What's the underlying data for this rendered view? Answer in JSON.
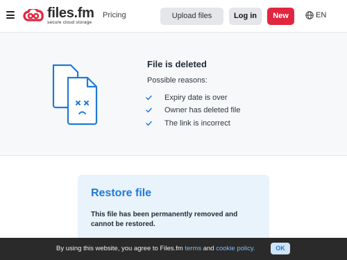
{
  "header": {
    "logo_text": "files.fm",
    "logo_tagline": "secure cloud storage",
    "pricing_label": "Pricing",
    "upload_label": "Upload files",
    "login_label": "Log in",
    "new_label": "New",
    "language": "EN"
  },
  "deleted": {
    "title": "File is deleted",
    "reasons_label": "Possible reasons:",
    "reasons": [
      "Expiry date is over",
      "Owner has deleted file",
      "The link is incorrect"
    ]
  },
  "restore": {
    "title": "Restore file",
    "message": "This file has been permanently removed and cannot be restored."
  },
  "cookie": {
    "text_before": "By using this website, you agree to Files.fm ",
    "terms_link": "terms",
    "text_and": " and ",
    "cookie_link": "cookie policy.",
    "ok_label": "OK"
  },
  "colors": {
    "brand_red": "#e2263f",
    "accent_blue": "#1f7ad6",
    "panel_bg": "#f7f8fa",
    "cookie_bg": "#2a2a2a"
  },
  "icons": [
    "menu-icon",
    "cloud-logo-icon",
    "globe-icon",
    "deleted-file-icon",
    "check-icon"
  ]
}
